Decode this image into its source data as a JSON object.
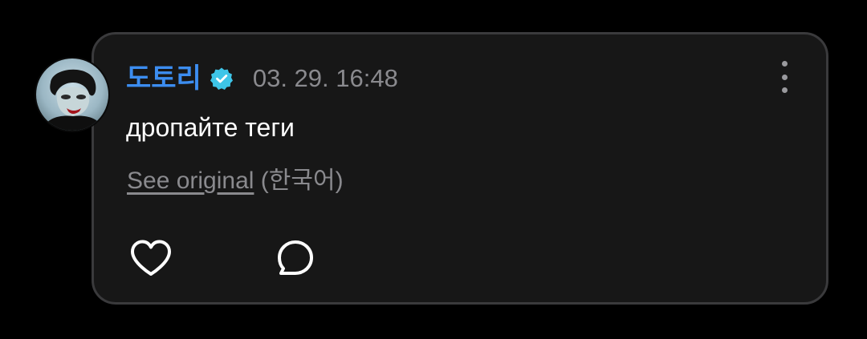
{
  "post": {
    "username": "도토리",
    "timestamp": "03. 29. 16:48",
    "text": "дропайте теги",
    "translation": {
      "see_original_label": "See original",
      "language_label": " (한국어)"
    }
  },
  "icons": {
    "verified": "verified-badge-icon",
    "more": "more-vertical-icon",
    "like": "heart-outline-icon",
    "comment": "comment-bubble-icon"
  },
  "colors": {
    "background": "#000000",
    "card": "#171717",
    "card_border": "#3a3a3c",
    "username": "#3c8df0",
    "verified_badge": "#3ec5e8",
    "muted_text": "#8a8a8e",
    "primary_text": "#ffffff"
  }
}
